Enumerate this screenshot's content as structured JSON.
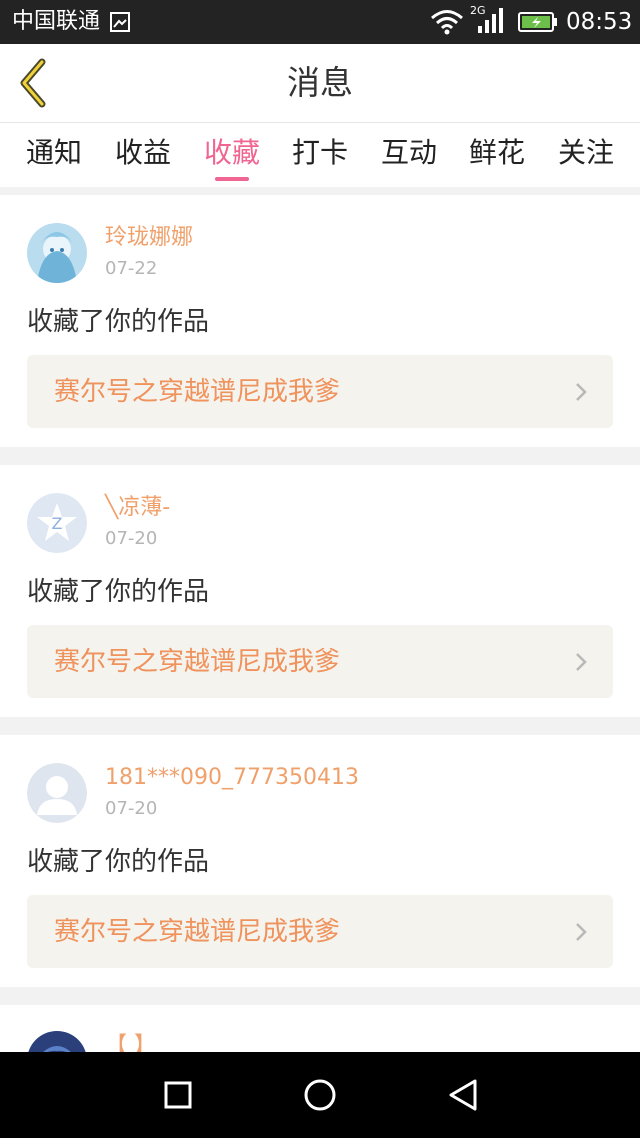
{
  "status_bar": {
    "carrier": "中国联通",
    "time": "08:53",
    "network": "2G"
  },
  "header": {
    "title": "消息"
  },
  "tabs": [
    {
      "label": "通知",
      "active": false
    },
    {
      "label": "收益",
      "active": false
    },
    {
      "label": "收藏",
      "active": true
    },
    {
      "label": "打卡",
      "active": false
    },
    {
      "label": "互动",
      "active": false
    },
    {
      "label": "鲜花",
      "active": false
    },
    {
      "label": "关注",
      "active": false
    }
  ],
  "messages": [
    {
      "username": "玲珑娜娜",
      "date": "07-22",
      "action": "收藏了你的作品",
      "work_title": "赛尔号之穿越谱尼成我爹",
      "avatar": "anime-avatar"
    },
    {
      "username": "╲凉薄-",
      "date": "07-20",
      "action": "收藏了你的作品",
      "work_title": "赛尔号之穿越谱尼成我爹",
      "avatar": "qzone-default-avatar"
    },
    {
      "username": "181***090_777350413",
      "date": "07-20",
      "action": "收藏了你的作品",
      "work_title": "赛尔号之穿越谱尼成我爹",
      "avatar": "default-person-avatar"
    },
    {
      "username": "【 】",
      "avatar": "anime-avatar"
    }
  ],
  "colors": {
    "accent": "#f06592",
    "username": "#f0a06a",
    "work_title": "#ef925c",
    "card_bg": "#f5f3ee"
  }
}
